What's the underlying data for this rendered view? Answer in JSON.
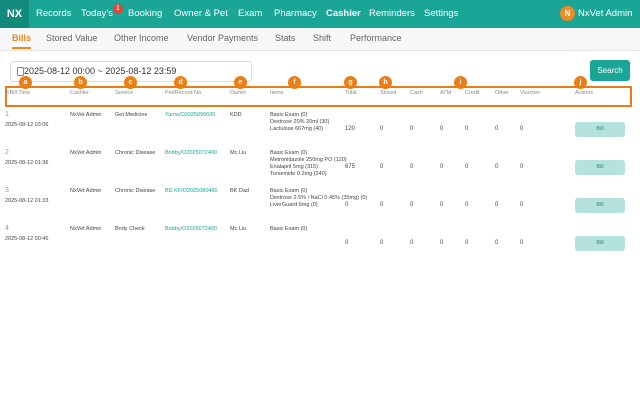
{
  "nav": {
    "logo": "NX",
    "items": [
      "Records",
      "Today's",
      "Booking",
      "Owner & Pet",
      "Exam",
      "Pharmacy",
      "Cashier",
      "Reminders",
      "Settings"
    ],
    "today_badge": "1",
    "active": "Cashier",
    "user_initial": "N",
    "user_name": "NxVet Admin"
  },
  "subtabs": {
    "items": [
      "Bills",
      "Stored Value",
      "Other Income",
      "Vendor Payments",
      "Stats",
      "Shift",
      "Performance"
    ],
    "active": "Bills"
  },
  "filter": {
    "date_range": "2025-08-12 00:00 ~ 2025-08-12 23:59",
    "search_label": "Search"
  },
  "table": {
    "headers": [
      "#/Bill Time",
      "Cashier",
      "Service",
      "Pet/Record No.",
      "Owner",
      "Items",
      "Total",
      "Stored",
      "Cash",
      "ATM",
      "Credit",
      "Other",
      "Voucher",
      "Actions"
    ],
    "markers": [
      "a",
      "b",
      "c",
      "d",
      "e",
      "f",
      "g",
      "h",
      "i",
      "j"
    ],
    "rows": [
      {
        "num": "1",
        "time": "2025-08-12 03:06",
        "cashier": "NxVet Admin",
        "service": "Get Medicine",
        "pet_record": "Yama/O2025090600",
        "owner": "KDD",
        "items": [
          "Basic Exam (0)",
          "Dextrose 20% 20ml (30)",
          "Lactulose 667mg (40)"
        ],
        "total": "120",
        "stored": "0",
        "cash": "0",
        "atm": "0",
        "credit": "0",
        "other": "0",
        "voucher": "0",
        "action": "Bill"
      },
      {
        "num": "2",
        "time": "2025-08-12 01:36",
        "cashier": "NxVet Admin",
        "service": "Chronic Disease",
        "pet_record": "Bobby/O2025072400",
        "owner": "Mc Liu",
        "items": [
          "Basic Exam (0)",
          "Metronidazole 250mg PO (120)",
          "Enalapril 5mg (315)",
          "Torsemide 0.2mg (240)"
        ],
        "total": "675",
        "stored": "0",
        "cash": "0",
        "atm": "0",
        "credit": "0",
        "other": "0",
        "voucher": "0",
        "action": "Bill"
      },
      {
        "num": "3",
        "time": "2025-08-12 01:33",
        "cashier": "NxVet Admin",
        "service": "Chronic Disease",
        "pet_record": "BD KF/O2025080460",
        "owner": "BK Dad",
        "items": [
          "Basic Exam (0)",
          "Dextrose 2.5% / NaCl 0.45% (35mg) (0)",
          "LiverGuard 6mg (0)"
        ],
        "total": "0",
        "stored": "0",
        "cash": "0",
        "atm": "0",
        "credit": "0",
        "other": "0",
        "voucher": "0",
        "action": "Bill"
      },
      {
        "num": "4",
        "time": "2025-08-12 00:46",
        "cashier": "NxVet Admin",
        "service": "Body Check",
        "pet_record": "Bobby/O2025072400",
        "owner": "Mc Liu",
        "items": [
          "Basic Exam (0)"
        ],
        "total": "0",
        "stored": "0",
        "cash": "0",
        "atm": "0",
        "credit": "0",
        "other": "0",
        "voucher": "0",
        "action": "Bill"
      }
    ]
  }
}
